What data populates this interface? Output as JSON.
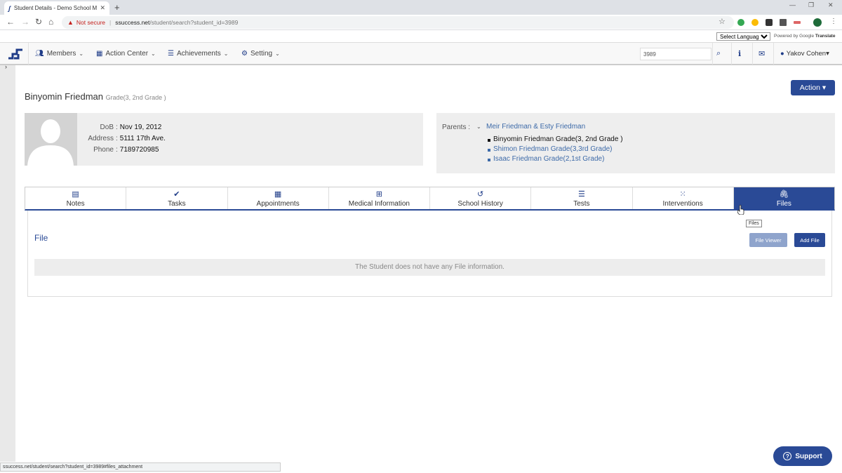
{
  "browser": {
    "tab_title": "Student Details - Demo School M",
    "not_secure": "Not secure",
    "url_host": "ssuccess.net",
    "url_path": "/student/search?student_id=3989",
    "status_url": "ssuccess.net/student/search?student_id=3989#files_attachment"
  },
  "translate": {
    "select_label": "Select Language",
    "powered_by": "Powered by",
    "google": "Google",
    "translate": "Translate"
  },
  "nav": {
    "members": "Members",
    "action_center": "Action Center",
    "achievements": "Achievements",
    "setting": "Setting",
    "search_value": "3989",
    "user": "Yakov Cohen"
  },
  "student": {
    "name": "Binyomin Friedman",
    "grade": "Grade(3, 2nd Grade )",
    "dob_label": "DoB",
    "dob": "Nov 19, 2012",
    "address_label": "Address",
    "address": "5111 17th Ave.",
    "phone_label": "Phone",
    "phone": "7189720985"
  },
  "action_label": "Action",
  "parents": {
    "label": "Parents :",
    "names": "Meir Friedman & Esty Friedman",
    "siblings": [
      "Binyomin Friedman Grade(3, 2nd Grade )",
      "Shimon Friedman Grade(3,3rd Grade)",
      "Isaac Friedman Grade(2,1st Grade)"
    ]
  },
  "tabs": [
    "Notes",
    "Tasks",
    "Appointments",
    "Medical Information",
    "School History",
    "Tests",
    "Interventions",
    "Files"
  ],
  "tooltip": "Files",
  "files": {
    "title": "File",
    "viewer_btn": "File Viewer",
    "add_btn": "Add File",
    "empty": "The Student does not have any File information."
  },
  "support": "Support",
  "colors": {
    "primary": "#2a4a96",
    "link": "#3d6aa8",
    "panel": "#eeeeee"
  }
}
